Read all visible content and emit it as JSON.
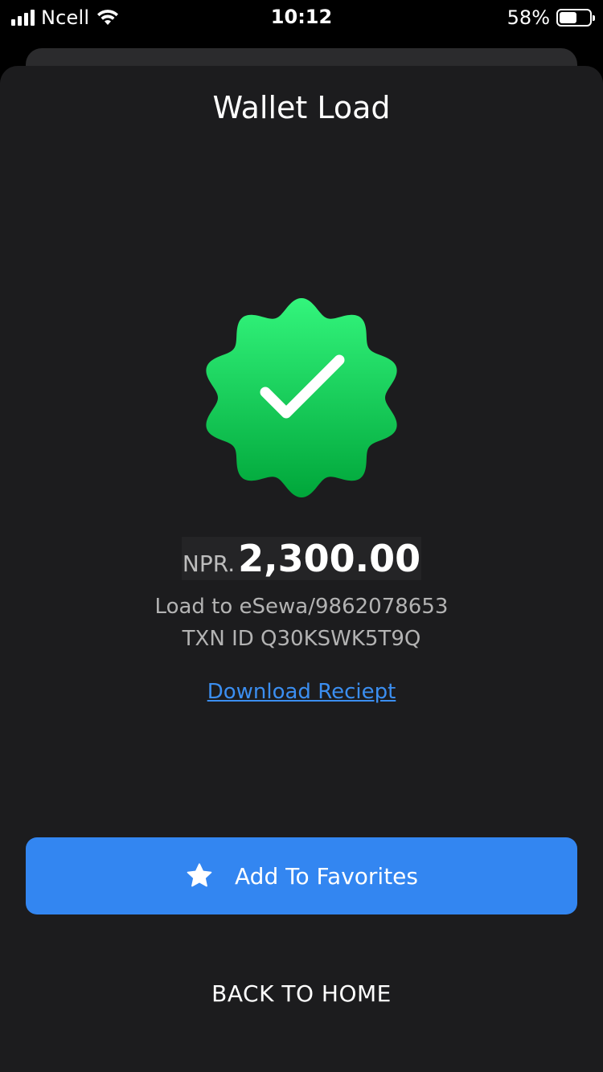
{
  "status_bar": {
    "carrier": "Ncell",
    "time": "10:12",
    "battery_percent": "58%",
    "battery_level": 0.58,
    "icons": [
      "signal-icon",
      "wifi-icon",
      "battery-icon"
    ]
  },
  "screen": {
    "title": "Wallet Load",
    "success_icon": "check-badge-icon",
    "success_color": "#19c14e",
    "currency": "NPR.",
    "amount": "2,300.00",
    "description": "Load to eSewa/9862078653",
    "txn_id": "TXN ID Q30KSWK5T9Q",
    "download_link": "Download Reciept",
    "favorites_button": "Add To Favorites",
    "favorites_icon": "star-icon",
    "accent_color": "#3386f1",
    "home_button": "BACK TO HOME"
  }
}
